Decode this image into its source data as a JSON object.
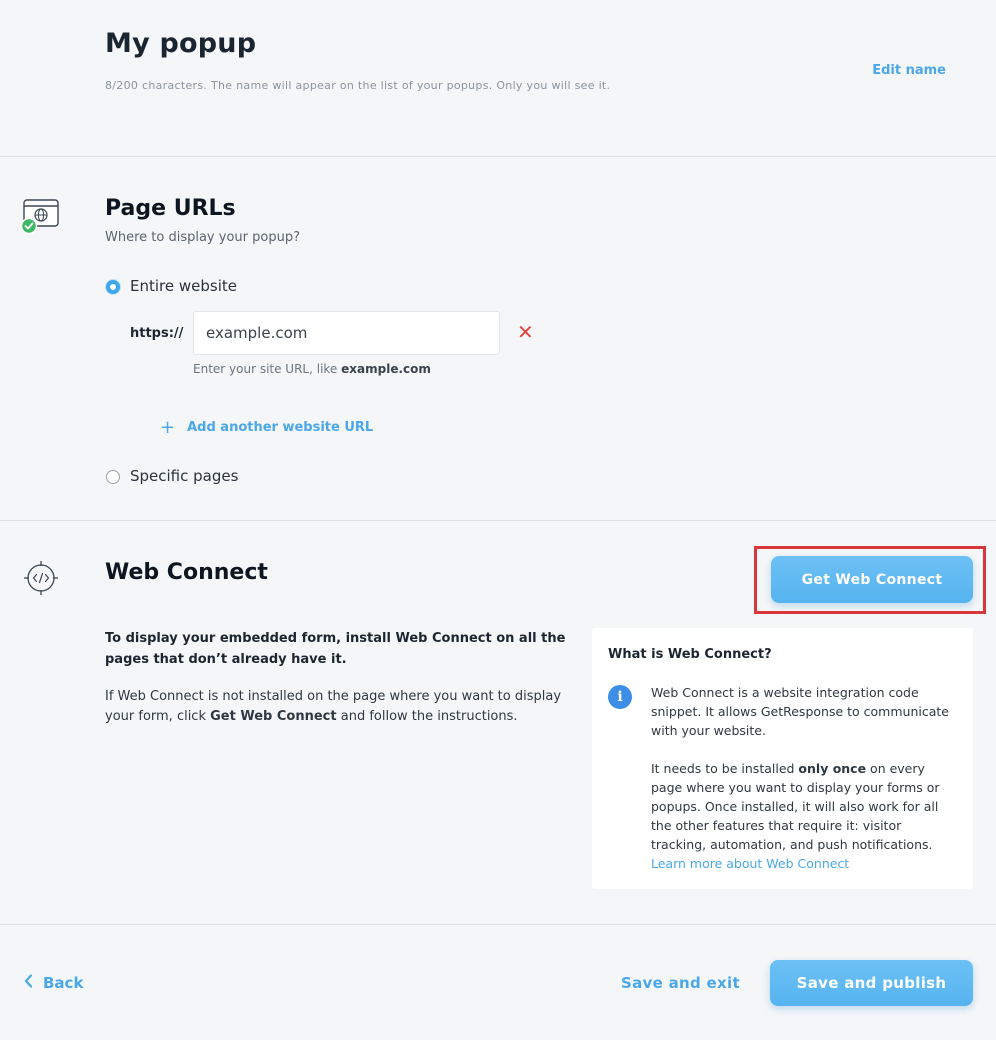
{
  "header": {
    "title": "My popup",
    "hint": "8/200 characters. The name will appear on the list of your popups. Only you will see it.",
    "edit_name": "Edit name"
  },
  "page_urls": {
    "icon": "browser-globe-check-icon",
    "title": "Page URLs",
    "subtitle": "Where to display your popup?",
    "option_entire": "Entire website",
    "option_specific": "Specific pages",
    "selected": "Entire website",
    "protocol": "https://",
    "url_value": "example.com",
    "url_hint_prefix": "Enter your site URL, like ",
    "url_hint_example": "example.com",
    "add_url_label": "Add another website URL"
  },
  "web_connect": {
    "icon": "code-target-icon",
    "title": "Web Connect",
    "button_label": "Get Web Connect",
    "intro_bold": "To display your embedded form, install Web Connect on all the pages that don’t already have it.",
    "body_prefix": "If Web Connect is not installed on the page where you want to display your form, click ",
    "body_bold": "Get Web Connect",
    "body_suffix": " and follow the instructions.",
    "info": {
      "title": "What is Web Connect?",
      "p1": "Web Connect is a website integration code snippet. It allows GetResponse to communicate with your website.",
      "p2_prefix": "It needs to be installed ",
      "p2_bold": "only once",
      "p2_suffix": " on every page where you want to display your forms or popups. Once installed, it will also work for all the other features that require it: visitor tracking, automation, and push notifications.",
      "link": "Learn more about Web Connect"
    }
  },
  "footer": {
    "back_label": "Back",
    "save_exit_label": "Save and exit",
    "save_publish_label": "Save and publish"
  },
  "colors": {
    "accent": "#4aa8e8",
    "primary_button": "#5cb8f2",
    "success": "#3db864",
    "error": "#e0453f",
    "highlight": "#d9363e"
  }
}
